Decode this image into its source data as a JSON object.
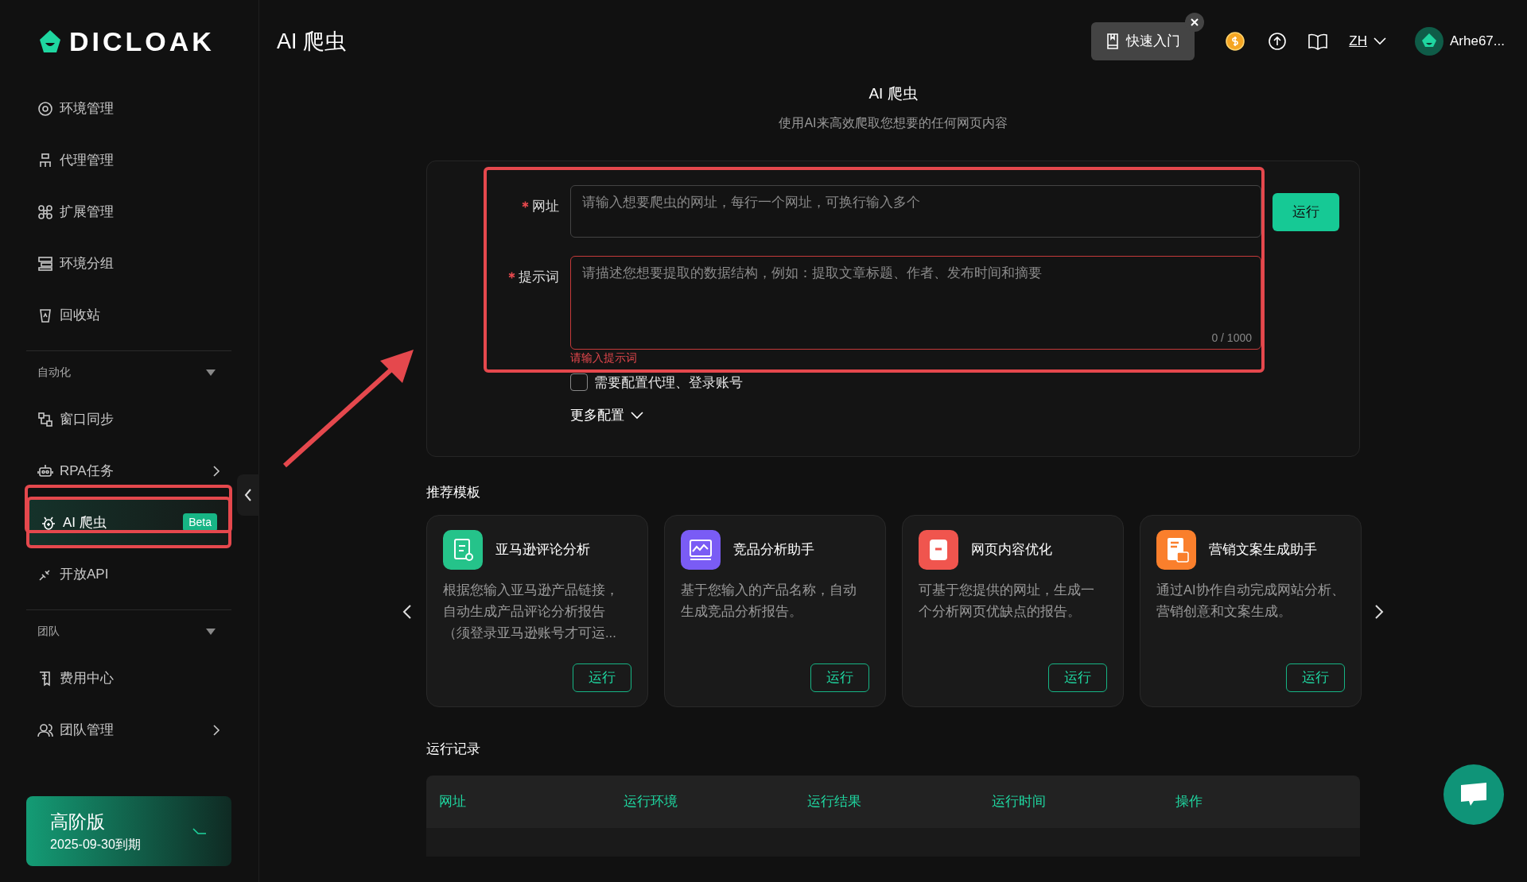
{
  "brand": {
    "logo_text": "DICLOAK"
  },
  "sidebar": {
    "items": [
      {
        "kind": "item",
        "label": "环境管理",
        "selected": false,
        "submenu": false
      },
      {
        "kind": "item",
        "label": "代理管理",
        "selected": false,
        "submenu": false
      },
      {
        "kind": "item",
        "label": "扩展管理",
        "selected": false,
        "submenu": false
      },
      {
        "kind": "item",
        "label": "环境分组",
        "selected": false,
        "submenu": false
      },
      {
        "kind": "item",
        "label": "回收站",
        "selected": false,
        "submenu": false
      },
      {
        "kind": "section",
        "label": "自动化",
        "expanded": true
      },
      {
        "kind": "item",
        "label": "窗口同步",
        "selected": false,
        "submenu": false
      },
      {
        "kind": "item",
        "label": "RPA任务",
        "selected": false,
        "submenu": true
      },
      {
        "kind": "item",
        "label": "AI 爬虫",
        "selected": true,
        "submenu": false,
        "badge": "Beta"
      },
      {
        "kind": "item",
        "label": "开放API",
        "selected": false,
        "submenu": false
      },
      {
        "kind": "section",
        "label": "团队",
        "expanded": true
      },
      {
        "kind": "item",
        "label": "费用中心",
        "selected": false,
        "submenu": false
      },
      {
        "kind": "item",
        "label": "团队管理",
        "selected": false,
        "submenu": true
      }
    ],
    "plan": {
      "name": "高阶版",
      "expiry": "2025-09-30到期"
    }
  },
  "header": {
    "title": "AI 爬虫",
    "quick_start": "快速入门",
    "language": "ZH",
    "user": "Arhe67..."
  },
  "page": {
    "title": "AI 爬虫",
    "subtitle": "使用AI来高效爬取您想要的任何网页内容"
  },
  "form": {
    "url": {
      "label": "网址",
      "required": true,
      "placeholder": "请输入想要爬虫的网址，每行一个网址，可换行输入多个"
    },
    "prompt": {
      "label": "提示词",
      "required": true,
      "placeholder": "请描述您想要提取的数据结构，例如：提取文章标题、作者、发布时间和摘要",
      "counter": "0 / 1000",
      "error": "请输入提示词"
    },
    "run_button": "运行",
    "proxy_option": {
      "label": "需要配置代理、登录账号",
      "checked": false
    },
    "more": "更多配置"
  },
  "templates": {
    "heading": "推荐模板",
    "items": [
      {
        "title": "亚马逊评论分析",
        "description": "根据您输入亚马逊产品链接，自动生成产品评论分析报告（须登录亚马逊账号才可运...",
        "button": "运行",
        "color": "#25c38a"
      },
      {
        "title": "竞品分析助手",
        "description": "基于您输入的产品名称，自动生成竞品分析报告。",
        "button": "运行",
        "color": "#7a5cf5"
      },
      {
        "title": "网页内容优化",
        "description": "可基于您提供的网址，生成一个分析网页优缺点的报告。",
        "button": "运行",
        "color": "#f0554e"
      },
      {
        "title": "营销文案生成助手",
        "description": "通过AI协作自动完成网站分析、营销创意和文案生成。",
        "button": "运行",
        "color": "#fa7f2c"
      }
    ]
  },
  "records": {
    "heading": "运行记录",
    "columns": [
      "网址",
      "运行环境",
      "运行结果",
      "运行时间",
      "操作"
    ]
  }
}
